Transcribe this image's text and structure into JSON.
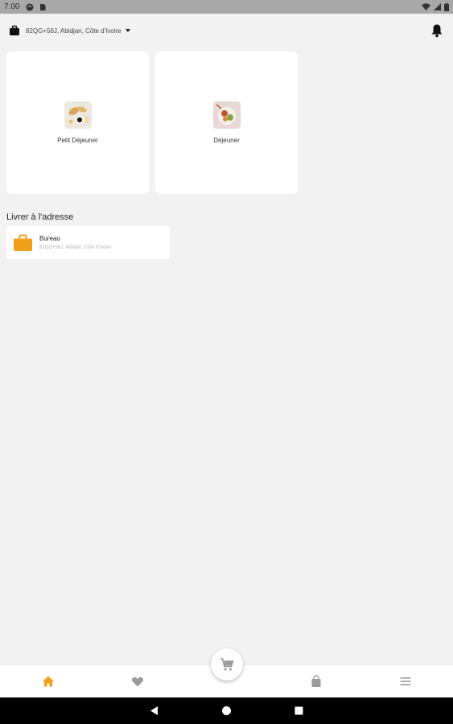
{
  "status_bar": {
    "time": "7:00",
    "icons_left": [
      "sync-icon",
      "sim-icon"
    ],
    "icons_right": [
      "wifi-icon",
      "signal-icon",
      "battery-icon"
    ]
  },
  "header": {
    "location_icon": "briefcase-icon",
    "location_text": "82QG+56J, Abidjan, Côte d'Ivoire",
    "notification_icon": "bell-icon"
  },
  "categories": [
    {
      "label": "Petit Déjeuner",
      "icon": "breakfast-thumbnail"
    },
    {
      "label": "Déjeuner",
      "icon": "lunch-thumbnail"
    }
  ],
  "delivery": {
    "title": "Livrer à l'adresse",
    "address": {
      "name": "Bureau",
      "line": "82QG+56J, Abidjan, Côte d'Ivoire",
      "icon": "briefcase-icon"
    }
  },
  "bottom_nav": {
    "items": [
      "home-icon",
      "heart-icon",
      "cart-icon",
      "shopping-bag-icon",
      "menu-icon"
    ],
    "active": "home-icon"
  },
  "colors": {
    "accent": "#f0a01a",
    "background": "#f2f2f2",
    "inactive_icon": "#9a9a9a"
  }
}
